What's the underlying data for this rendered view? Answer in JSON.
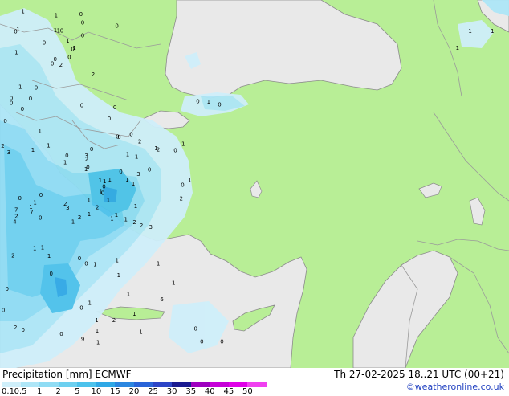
{
  "header": {
    "product": "Precipitation [mm]",
    "model": "ECMWF",
    "valid_time": "Th 27-02-2025 18..21 UTC (00+21)"
  },
  "credit": "©weatheronline.co.uk",
  "legend": {
    "labels": [
      "0.1",
      "0.5",
      "1",
      "2",
      "5",
      "10",
      "15",
      "20",
      "25",
      "30",
      "35",
      "40",
      "45",
      "50"
    ],
    "colors": [
      "#cfeffa",
      "#aee6f7",
      "#8fdcf4",
      "#6dd0f0",
      "#4cc2ec",
      "#2fa8e6",
      "#2b86e0",
      "#2a64d8",
      "#2d45c6",
      "#1a1a90",
      "#9e00c0",
      "#c600d8",
      "#e000e8",
      "#f040f0"
    ]
  },
  "colors": {
    "land": "#b8ee96",
    "sea": "#e9e9e9",
    "border": "#9a9a9a",
    "coast": "#8c8c8c"
  },
  "map_values": [
    "2",
    "0",
    "0",
    "0",
    "0",
    "0",
    "0",
    "0",
    "0",
    "0",
    "1",
    "0",
    "1",
    "0",
    "0",
    "0",
    "0",
    "1",
    "1",
    "1",
    "0",
    "0",
    "0",
    "1",
    "1",
    "2",
    "1",
    "1",
    "3",
    "1",
    "2",
    "1",
    "2",
    "0",
    "1",
    "0",
    "0",
    "1",
    "1",
    "1",
    "0",
    "1",
    "1",
    "1",
    "0",
    "2",
    "3",
    "4",
    "3",
    "2",
    "0",
    "0",
    "0",
    "0",
    "2",
    "1",
    "7",
    "7",
    "1",
    "3",
    "1",
    "0",
    "2",
    "1",
    "2",
    "1",
    "1",
    "1",
    "0",
    "0",
    "0",
    "0",
    "1",
    "1",
    "2",
    "2",
    "1",
    "0",
    "0",
    "1",
    "1",
    "0",
    "1",
    "6",
    "9",
    "1",
    "1",
    "1",
    "1",
    "2",
    "2",
    "1",
    "1",
    "1",
    "3",
    "2",
    "0",
    "2",
    "1",
    "2",
    "1",
    "0",
    "1",
    "1",
    "0",
    "1",
    "1",
    "0",
    "0",
    "0",
    "0",
    "0",
    "1",
    "1",
    "0",
    "1",
    "1",
    "1",
    "1",
    "1",
    "1",
    "1",
    "1",
    "0",
    "0",
    "0",
    "0",
    "0"
  ]
}
